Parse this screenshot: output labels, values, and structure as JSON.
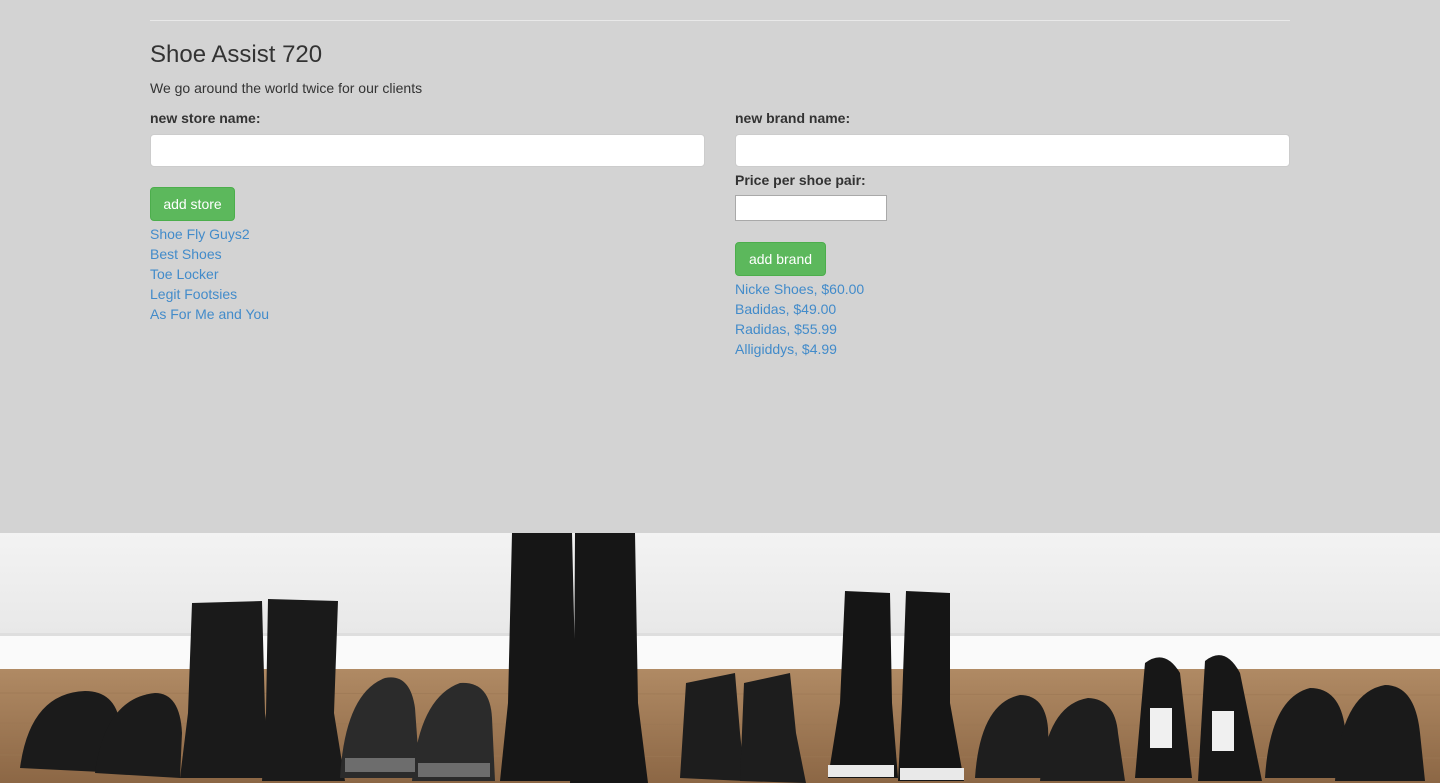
{
  "header": {
    "title": "Shoe Assist 720",
    "tagline": "We go around the world twice for our clients"
  },
  "store_form": {
    "label": "new store name:",
    "value": "",
    "placeholder": "",
    "button_label": "add store",
    "stores": [
      "Shoe Fly Guys2",
      "Best Shoes",
      "Toe Locker",
      "Legit Footsies",
      "As For Me and You"
    ]
  },
  "brand_form": {
    "label": "new brand name:",
    "value": "",
    "placeholder": "",
    "price_label": "Price per shoe pair:",
    "price_value": "",
    "button_label": "add brand",
    "brands": [
      "Nicke Shoes, $60.00",
      "Badidas, $49.00",
      "Radidas, $55.99",
      "Alligiddys, $4.99"
    ]
  },
  "colors": {
    "background": "#d3d3d3",
    "button_green": "#5cb85c",
    "link_blue": "#428bca"
  },
  "footer_image": {
    "icon": "shoes-row-photo"
  }
}
